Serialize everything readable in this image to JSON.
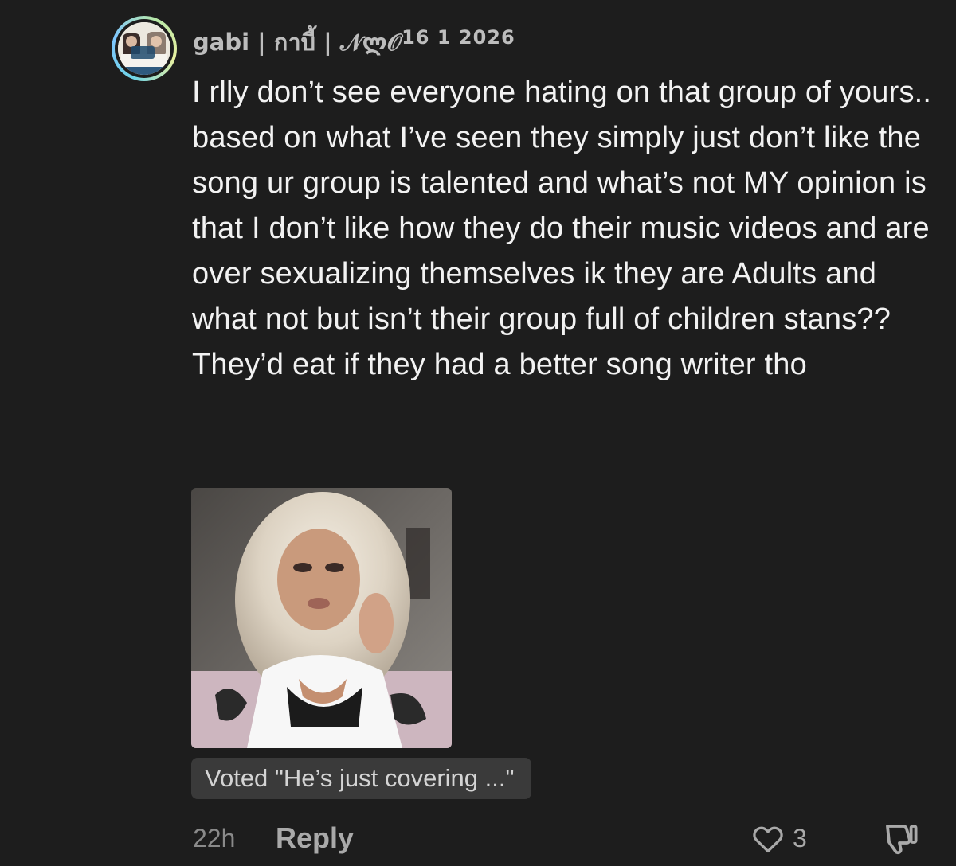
{
  "comment": {
    "username": "gabi | กาบี้ | 𝒩ლ𝒪",
    "date": "16 1 2026",
    "text": "I rlly don’t see everyone hating on that group of yours.. based on what I’ve seen they simply just don’t like the song ur group is talented and what’s not MY opinion is that I don’t like how they do their music videos and are over sexualizing themselves ik they are Adults and what not but isn’t their group full of children stans?? They’d eat if they had a better song writer tho",
    "vote_label": "Voted \"He’s just covering ...\"",
    "time_ago": "22h",
    "reply_label": "Reply",
    "like_count": "3"
  },
  "icons": {
    "like": "heart-outline-icon",
    "dislike": "thumbs-down-outline-icon"
  },
  "colors": {
    "background": "#1d1d1d",
    "text": "#f2f2f2",
    "muted": "#a9a9a9",
    "pill": "#3a3a3a"
  }
}
